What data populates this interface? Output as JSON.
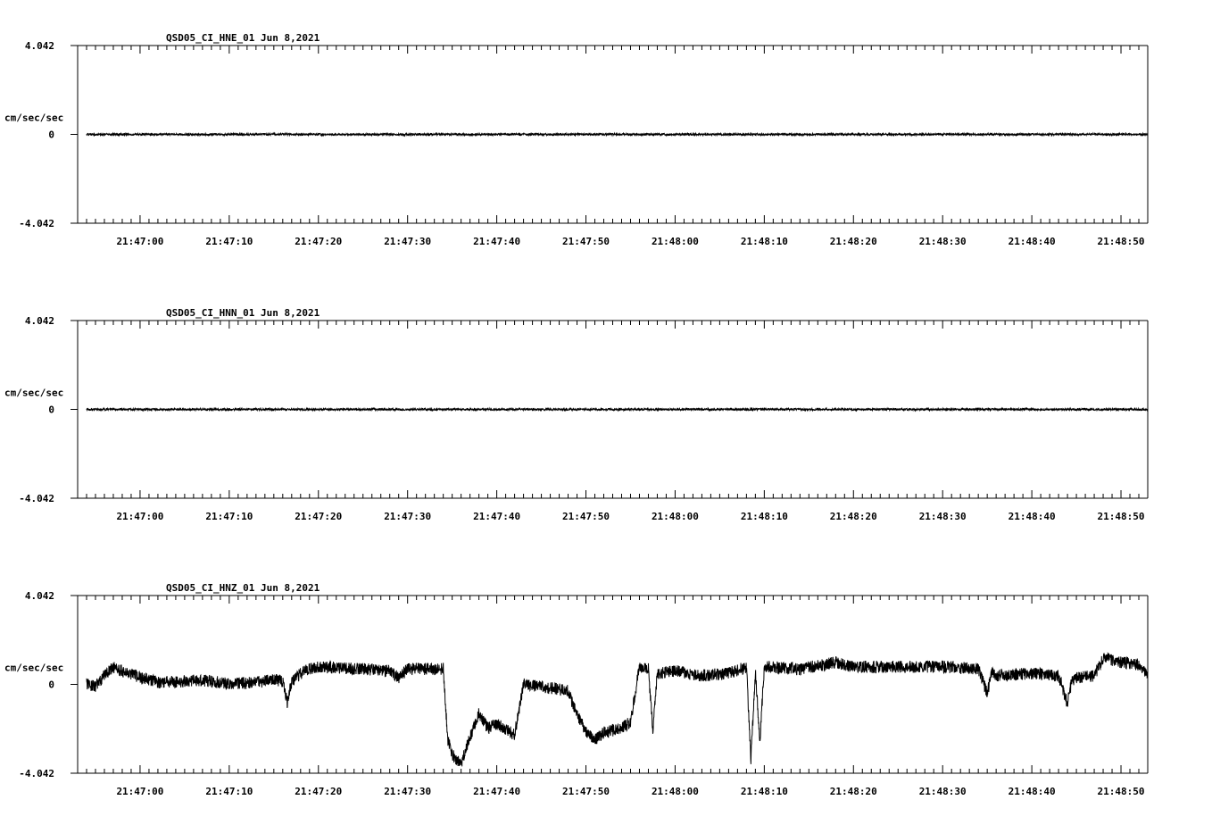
{
  "chart_data": [
    {
      "type": "line",
      "title": "QSD05_CI_HNE_01  Jun 8,2021",
      "ylabel": "cm/sec/sec",
      "ylim": [
        -4.042,
        4.042
      ],
      "y_tick_labels": [
        "4.042",
        "0",
        "-4.042"
      ],
      "x_range": [
        "21:46:53",
        "21:48:53"
      ],
      "x_tick_labels": [
        "21:47:00",
        "21:47:10",
        "21:47:20",
        "21:47:30",
        "21:47:40",
        "21:47:50",
        "21:48:00",
        "21:48:10",
        "21:48:20",
        "21:48:30",
        "21:48:40",
        "21:48:50"
      ],
      "series": [
        {
          "x": [
            "21:46:54",
            "21:47:00",
            "21:47:10",
            "21:47:20",
            "21:47:30",
            "21:47:40",
            "21:47:50",
            "21:48:00",
            "21:48:10",
            "21:48:20",
            "21:48:30",
            "21:48:40",
            "21:48:50",
            "21:48:53"
          ],
          "values": [
            0,
            0,
            0,
            0,
            0,
            0,
            0,
            0,
            0,
            0,
            0,
            0,
            0,
            0
          ]
        }
      ]
    },
    {
      "type": "line",
      "title": "QSD05_CI_HNN_01  Jun 8,2021",
      "ylabel": "cm/sec/sec",
      "ylim": [
        -4.042,
        4.042
      ],
      "y_tick_labels": [
        "4.042",
        "0",
        "-4.042"
      ],
      "x_range": [
        "21:46:53",
        "21:48:53"
      ],
      "x_tick_labels": [
        "21:47:00",
        "21:47:10",
        "21:47:20",
        "21:47:30",
        "21:47:40",
        "21:47:50",
        "21:48:00",
        "21:48:10",
        "21:48:20",
        "21:48:30",
        "21:48:40",
        "21:48:50"
      ],
      "series": [
        {
          "x": [
            "21:46:54",
            "21:47:00",
            "21:47:10",
            "21:47:20",
            "21:47:30",
            "21:47:40",
            "21:47:50",
            "21:48:00",
            "21:48:10",
            "21:48:20",
            "21:48:30",
            "21:48:40",
            "21:48:50",
            "21:48:53"
          ],
          "values": [
            0,
            0,
            0,
            0,
            0,
            0,
            0,
            0,
            0,
            0,
            0,
            0,
            0,
            0
          ]
        }
      ]
    },
    {
      "type": "line",
      "title": "QSD05_CI_HNZ_01  Jun 8,2021",
      "ylabel": "cm/sec/sec",
      "ylim": [
        -4.042,
        4.042
      ],
      "y_tick_labels": [
        "4.042",
        "0",
        "-4.042"
      ],
      "x_range": [
        "21:46:53",
        "21:48:53"
      ],
      "x_tick_labels": [
        "21:47:00",
        "21:47:10",
        "21:47:20",
        "21:47:30",
        "21:47:40",
        "21:47:50",
        "21:48:00",
        "21:48:10",
        "21:48:20",
        "21:48:30",
        "21:48:40",
        "21:48:50"
      ],
      "series": [
        {
          "x": [
            "21:46:54",
            "21:46:55",
            "21:46:56",
            "21:46:57",
            "21:46:58",
            "21:46:59",
            "21:47:00",
            "21:47:02",
            "21:47:04",
            "21:47:06",
            "21:47:08",
            "21:47:10",
            "21:47:13",
            "21:47:15",
            "21:47:16",
            "21:47:16.5",
            "21:47:17",
            "21:47:18",
            "21:47:19",
            "21:47:20",
            "21:47:25",
            "21:47:28",
            "21:47:29",
            "21:47:30",
            "21:47:31",
            "21:47:33",
            "21:47:34",
            "21:47:34.5",
            "21:47:35",
            "21:47:36",
            "21:47:37",
            "21:47:38",
            "21:47:39",
            "21:47:40",
            "21:47:42",
            "21:47:43",
            "21:47:45",
            "21:47:48",
            "21:47:49",
            "21:47:50",
            "21:47:51",
            "21:47:52",
            "21:47:54",
            "21:47:55",
            "21:47:56",
            "21:47:57",
            "21:47:57.5",
            "21:47:58",
            "21:48:00",
            "21:48:03",
            "21:48:06",
            "21:48:08",
            "21:48:08.5",
            "21:48:09",
            "21:48:09.5",
            "21:48:10",
            "21:48:14",
            "21:48:18",
            "21:48:20",
            "21:48:25",
            "21:48:30",
            "21:48:34",
            "21:48:35",
            "21:48:35.5",
            "21:48:36",
            "21:48:40",
            "21:48:43",
            "21:48:44",
            "21:48:44.5",
            "21:48:45",
            "21:48:47",
            "21:48:48",
            "21:48:50",
            "21:48:52",
            "21:48:53"
          ],
          "values": [
            0,
            -0.1,
            0.4,
            0.8,
            0.6,
            0.5,
            0.3,
            0.1,
            0.1,
            0.2,
            0.15,
            0,
            0.1,
            0.2,
            0.15,
            -0.8,
            0.1,
            0.5,
            0.7,
            0.8,
            0.7,
            0.6,
            0.3,
            0.7,
            0.7,
            0.7,
            0.7,
            -2.5,
            -3.2,
            -3.6,
            -2.4,
            -1.3,
            -2,
            -1.8,
            -2.3,
            0,
            -0.1,
            -0.3,
            -1.4,
            -2.1,
            -2.5,
            -2.2,
            -2.0,
            -1.7,
            0.8,
            0.7,
            -2.1,
            0.5,
            0.6,
            0.4,
            0.5,
            0.8,
            -3.4,
            0.6,
            -2.6,
            0.8,
            0.7,
            1.0,
            0.8,
            0.8,
            0.8,
            0.7,
            -0.4,
            0.5,
            0.4,
            0.5,
            0.4,
            -0.9,
            0.2,
            0.3,
            0.4,
            1.2,
            1.0,
            0.9,
            0.5
          ]
        }
      ]
    }
  ]
}
